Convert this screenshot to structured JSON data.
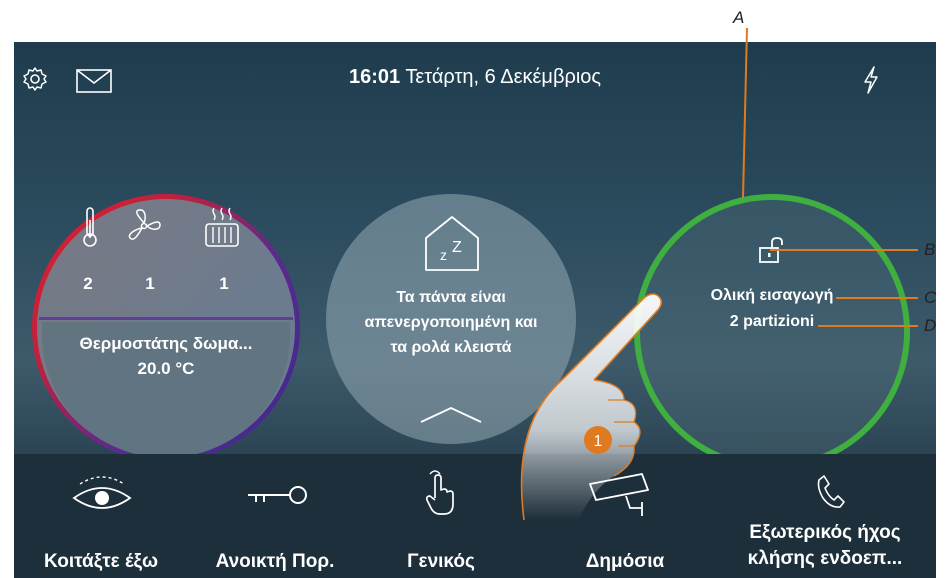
{
  "status_bar": {
    "time": "16:01",
    "date": "Τετάρτη, 6 Δεκέμβριος"
  },
  "thermostat": {
    "counts": [
      "2",
      "1",
      "1"
    ],
    "name": "Θερμοστάτης δωμα...",
    "temperature": "20.0 °C"
  },
  "scenario": {
    "line1": "Τα πάντα είναι",
    "line2": "απενεργοποιημένη και",
    "line3": "τα ρολά κλειστά"
  },
  "alarm": {
    "status": "Ολική εισαγωγή",
    "partitions": "2 partizioni"
  },
  "bottom_nav": [
    {
      "label": "Κοιτάξτε έξω",
      "icon": "eye-icon"
    },
    {
      "label": "Ανοικτή Πορ.",
      "icon": "key-icon"
    },
    {
      "label": "Γενικός",
      "icon": "hand-pointer-icon"
    },
    {
      "label": "Δημόσια",
      "icon": "camera-icon"
    },
    {
      "label_line1": "Εξωτερικός ήχος",
      "label_line2": "κλήσης ενδοεπ...",
      "icon": "phone-icon"
    }
  ],
  "callouts": {
    "a": "A",
    "b": "B",
    "c": "C",
    "d": "D",
    "step": "1"
  },
  "colors": {
    "alarm_ring": "#3fb03f",
    "callout_line": "#e07a20",
    "bottom_bar": "#1d2f3b"
  }
}
